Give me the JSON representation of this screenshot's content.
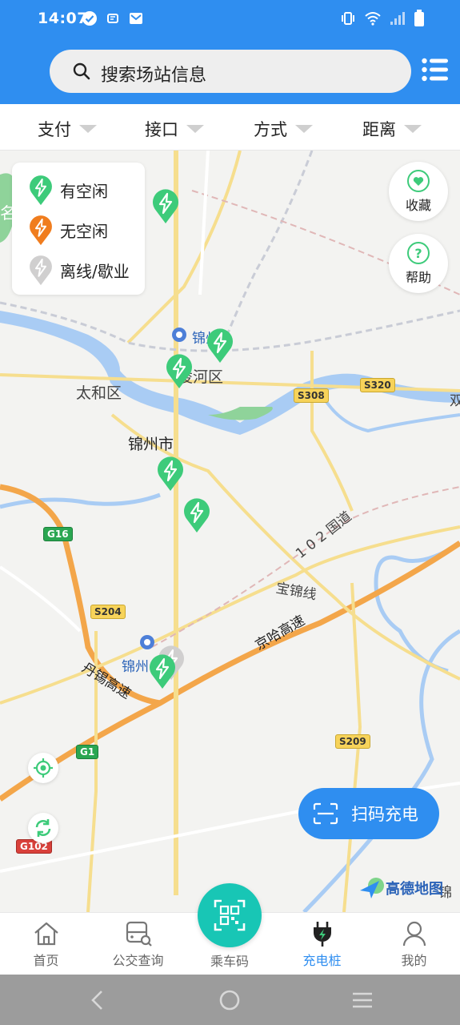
{
  "status": {
    "time": "14:07",
    "left_icons": [
      "check-circle-icon",
      "cloud-icon",
      "mail-icon"
    ],
    "right_icons": [
      "vibrate-icon",
      "wifi-icon",
      "signal-icon",
      "battery-icon"
    ]
  },
  "search": {
    "placeholder": "搜索场站信息",
    "menu_icon": "list-menu-icon"
  },
  "filters": [
    {
      "label": "支付"
    },
    {
      "label": "接口"
    },
    {
      "label": "方式"
    },
    {
      "label": "距离"
    }
  ],
  "legend": [
    {
      "label": "有空闲",
      "color": "#3dcb7a"
    },
    {
      "label": "无空闲",
      "color": "#f07d1e"
    },
    {
      "label": "离线/歇业",
      "color": "#c8c8c8"
    }
  ],
  "side_buttons": {
    "favorite": {
      "label": "收藏",
      "icon": "heart-icon"
    },
    "help": {
      "label": "帮助",
      "icon": "question-icon"
    }
  },
  "map": {
    "labels": {
      "taihe": "太和区",
      "linghe": "凌河区",
      "jinzhou_city": "锦州市",
      "station_north": "锦州",
      "station_south": "锦州",
      "national_road": "1 0 2 国道",
      "baojin": "宝锦线",
      "jingha": "京哈高速",
      "danxi": "丹锡高速",
      "edge_left": "名",
      "edge_right": "锦",
      "edge_right2": "双"
    },
    "shields": {
      "s308": "S308",
      "s320": "S320",
      "g16": "G16",
      "s204": "S204",
      "g1": "G1",
      "s209": "S209",
      "g102": "G102"
    },
    "logo": "高德地图"
  },
  "scan_button": {
    "label": "扫码充电",
    "icon": "scan-icon"
  },
  "tabs": [
    {
      "label": "首页",
      "icon": "home-icon"
    },
    {
      "label": "公交查询",
      "icon": "bus-search-icon"
    },
    {
      "label": "乘车码",
      "icon": "qr-code-icon"
    },
    {
      "label": "充电桩",
      "icon": "charging-plug-icon"
    },
    {
      "label": "我的",
      "icon": "user-icon"
    }
  ],
  "active_tab": "充电桩",
  "colors": {
    "primary": "#2f8ef0",
    "available": "#3dcb7a",
    "busy": "#f07d1e",
    "offline": "#c8c8c8",
    "qr_teal": "#18c6b5"
  }
}
